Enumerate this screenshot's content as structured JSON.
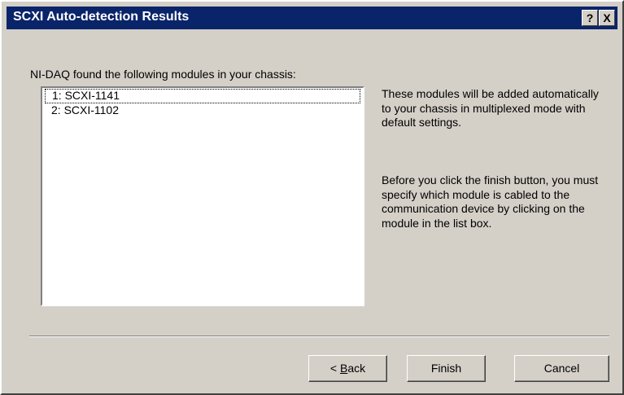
{
  "window": {
    "title": "SCXI Auto-detection Results",
    "help_label": "?",
    "close_label": "X"
  },
  "prompt": "NI-DAQ found the following modules in your chassis:",
  "modules": [
    {
      "label": "1: SCXI-1141"
    },
    {
      "label": "2: SCXI-1102"
    }
  ],
  "info": {
    "paragraph1": "These modules will be added automatically to your chassis in multiplexed mode with default settings.",
    "paragraph2": "Before you click the finish button, you must specify which module is cabled to the communication device by clicking on the module in the list box."
  },
  "buttons": {
    "back_prefix": "< ",
    "back_mnemonic": "B",
    "back_rest": "ack",
    "finish": "Finish",
    "cancel": "Cancel"
  }
}
